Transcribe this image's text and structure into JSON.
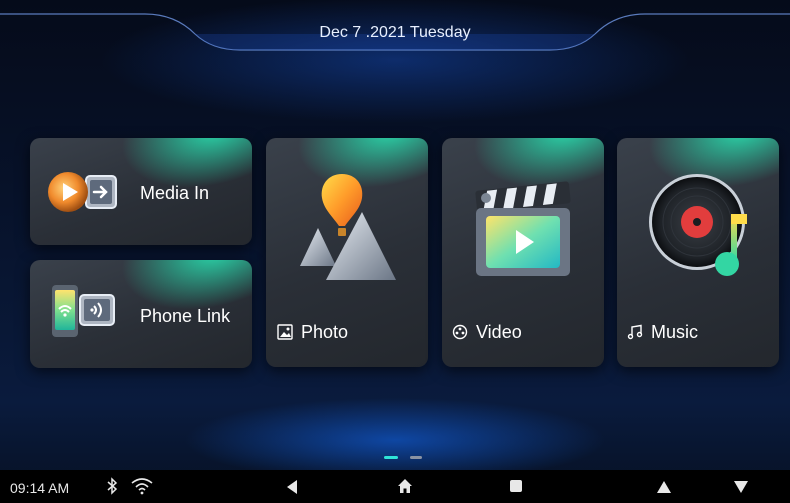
{
  "header": {
    "date": "Dec 7 .2021  Tuesday"
  },
  "tiles": {
    "media_in": {
      "label": "Media In"
    },
    "phone_link": {
      "label": "Phone Link"
    },
    "photo": {
      "label": "Photo"
    },
    "video": {
      "label": "Video"
    },
    "music": {
      "label": "Music"
    }
  },
  "pager": {
    "current_page": 1,
    "page_count": 2
  },
  "status_bar": {
    "time": "09:14 AM",
    "icons": [
      "bluetooth-icon",
      "wifi-icon"
    ]
  },
  "nav_bar": {
    "buttons": [
      "back-icon",
      "home-icon",
      "recents-icon",
      "volume-up-icon",
      "volume-down-icon"
    ]
  },
  "colors": {
    "accent": "#2fe3b4",
    "background": "#07122a",
    "card": "#2f353d"
  }
}
